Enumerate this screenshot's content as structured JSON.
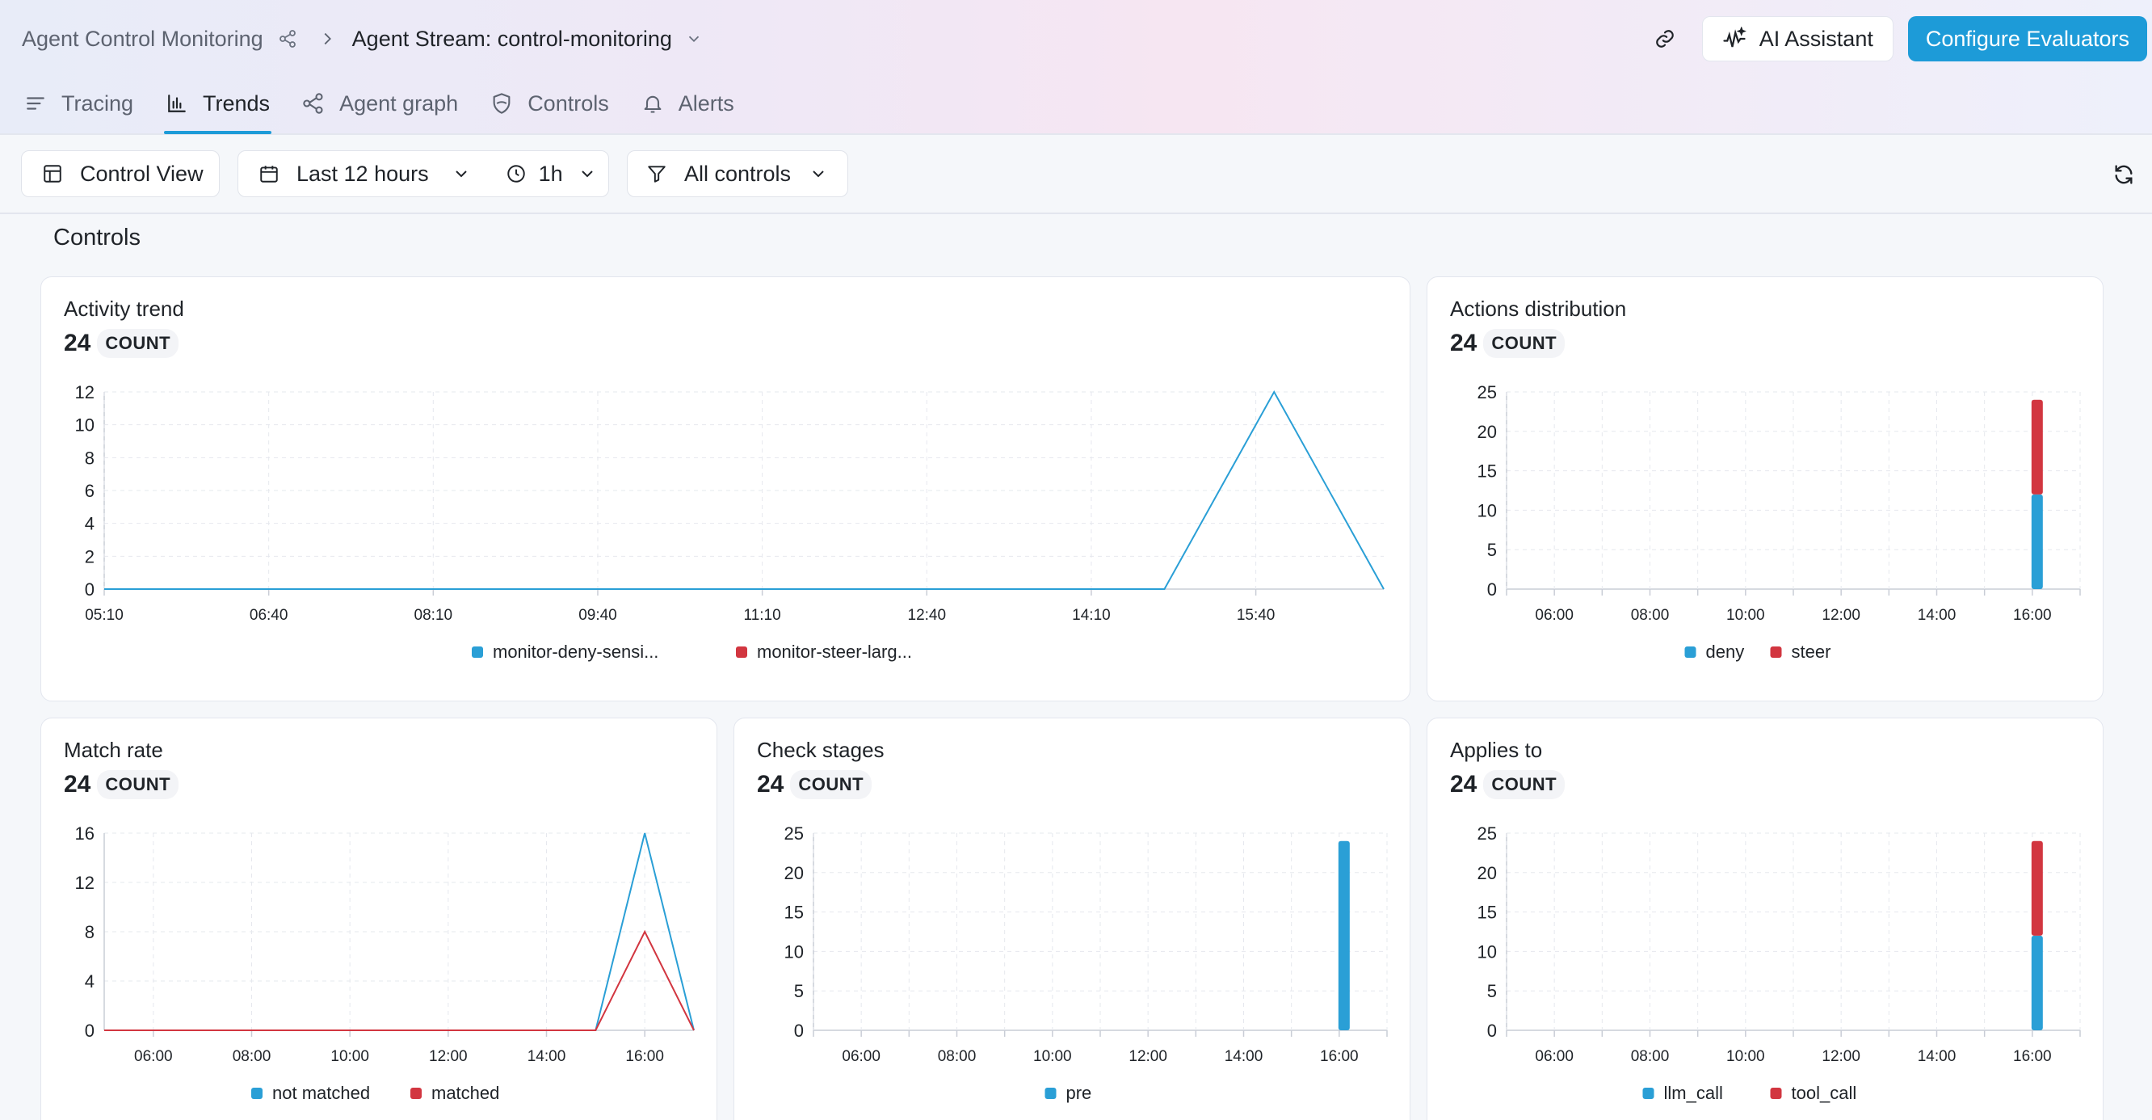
{
  "header": {
    "breadcrumb_parent": "Agent Control Monitoring",
    "breadcrumb_current": "Agent Stream: control-monitoring",
    "ai_assistant_label": "AI Assistant",
    "configure_label": "Configure Evaluators"
  },
  "tabs": [
    {
      "label": "Tracing",
      "icon": "list-icon",
      "active": false
    },
    {
      "label": "Trends",
      "icon": "bar-chart-icon",
      "active": true
    },
    {
      "label": "Agent graph",
      "icon": "graph-icon",
      "active": false
    },
    {
      "label": "Controls",
      "icon": "shield-icon",
      "active": false
    },
    {
      "label": "Alerts",
      "icon": "bell-icon",
      "active": false
    }
  ],
  "toolbar": {
    "view_label": "Control View",
    "time_range_label": "Last 12 hours",
    "interval_label": "1h",
    "filter_label": "All controls"
  },
  "section": {
    "title": "Controls"
  },
  "colors": {
    "blue": "#2a9fd6",
    "red": "#d23640",
    "accent": "#1d9bd8"
  },
  "chart_data": [
    {
      "id": "activity",
      "type": "line",
      "title": "Activity trend",
      "count": "24",
      "count_label": "COUNT",
      "x": [
        "05:10",
        "06:40",
        "08:10",
        "09:40",
        "11:10",
        "12:40",
        "14:10",
        "15:40"
      ],
      "ylim": [
        0,
        12
      ],
      "yticks": [
        0,
        2,
        4,
        6,
        8,
        10,
        12
      ],
      "series": [
        {
          "name": "monitor-deny-sensi...",
          "color": "#2a9fd6",
          "points": [
            [
              "05:10",
              0
            ],
            [
              "14:10",
              0
            ],
            [
              "14:50",
              0
            ],
            [
              "15:50",
              12
            ],
            [
              "16:50",
              0
            ]
          ]
        },
        {
          "name": "monitor-steer-larg...",
          "color": "#d23640",
          "points": []
        }
      ]
    },
    {
      "id": "actions",
      "type": "bar",
      "title": "Actions distribution",
      "count": "24",
      "count_label": "COUNT",
      "categories": [
        "06:00",
        "08:00",
        "10:00",
        "12:00",
        "14:00",
        "16:00"
      ],
      "ylim": [
        0,
        25
      ],
      "yticks": [
        0,
        5,
        10,
        15,
        20,
        25
      ],
      "stacked": true,
      "series": [
        {
          "name": "deny",
          "color": "#2a9fd6",
          "points": [
            [
              "16:00",
              12
            ]
          ]
        },
        {
          "name": "steer",
          "color": "#d23640",
          "points": [
            [
              "16:00",
              12
            ]
          ]
        }
      ]
    },
    {
      "id": "match",
      "type": "line",
      "title": "Match rate",
      "count": "24",
      "count_label": "COUNT",
      "x": [
        "06:00",
        "08:00",
        "10:00",
        "12:00",
        "14:00",
        "16:00"
      ],
      "ylim": [
        0,
        16
      ],
      "yticks": [
        0,
        4,
        8,
        12,
        16
      ],
      "series": [
        {
          "name": "not matched",
          "color": "#2a9fd6",
          "points": [
            [
              "05:00",
              0
            ],
            [
              "15:00",
              0
            ],
            [
              "16:00",
              16
            ],
            [
              "17:00",
              0
            ]
          ]
        },
        {
          "name": "matched",
          "color": "#d23640",
          "points": [
            [
              "05:00",
              0
            ],
            [
              "15:00",
              0
            ],
            [
              "16:00",
              8
            ],
            [
              "17:00",
              0
            ]
          ]
        }
      ]
    },
    {
      "id": "stages",
      "type": "bar",
      "title": "Check stages",
      "count": "24",
      "count_label": "COUNT",
      "categories": [
        "06:00",
        "08:00",
        "10:00",
        "12:00",
        "14:00",
        "16:00"
      ],
      "ylim": [
        0,
        25
      ],
      "yticks": [
        0,
        5,
        10,
        15,
        20,
        25
      ],
      "stacked": true,
      "series": [
        {
          "name": "pre",
          "color": "#2a9fd6",
          "points": [
            [
              "16:00",
              24
            ]
          ]
        }
      ]
    },
    {
      "id": "applies",
      "type": "bar",
      "title": "Applies to",
      "count": "24",
      "count_label": "COUNT",
      "categories": [
        "06:00",
        "08:00",
        "10:00",
        "12:00",
        "14:00",
        "16:00"
      ],
      "ylim": [
        0,
        25
      ],
      "yticks": [
        0,
        5,
        10,
        15,
        20,
        25
      ],
      "stacked": true,
      "series": [
        {
          "name": "llm_call",
          "color": "#2a9fd6",
          "points": [
            [
              "16:00",
              12
            ]
          ]
        },
        {
          "name": "tool_call",
          "color": "#d23640",
          "points": [
            [
              "16:00",
              12
            ]
          ]
        }
      ]
    }
  ]
}
